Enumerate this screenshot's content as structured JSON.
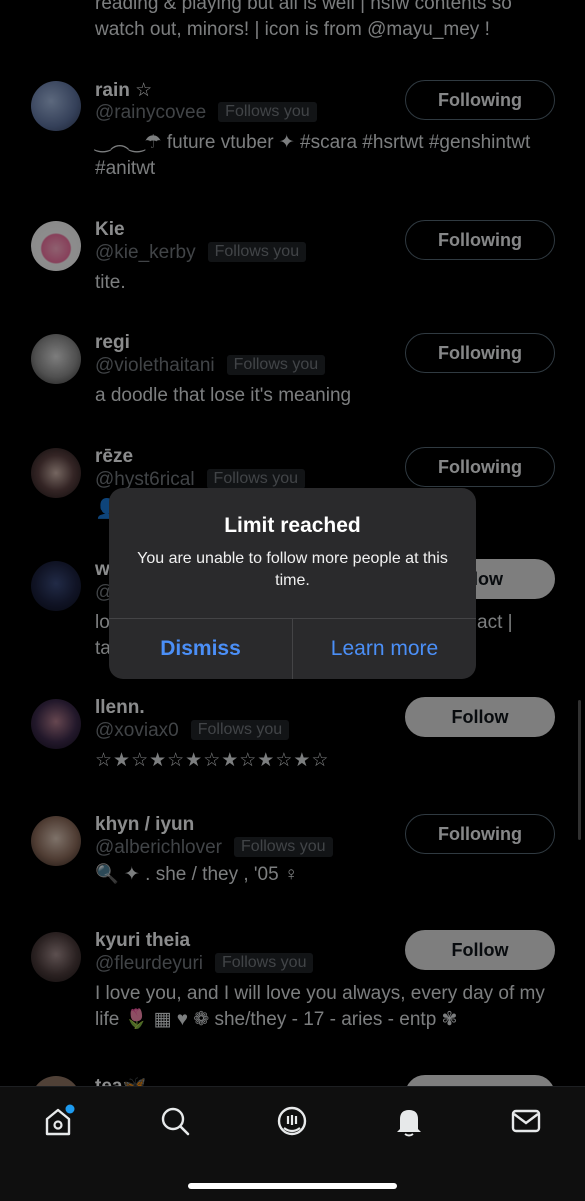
{
  "top_bio": {
    "line1": "reading & playing but all is well | nsfw contents so",
    "line2": "watch out, minors! | icon is from @mayu_mey !"
  },
  "users": [
    {
      "name": "rain ☆",
      "handle": "@rainycovee",
      "badge": "Follows you",
      "bio": "‿︵‿☂ future vtuber ✦ #scara #hsrtwt #genshintwt #anitwt",
      "button": "Following"
    },
    {
      "name": "Kie",
      "handle": "@kie_kerby",
      "badge": "Follows you",
      "bio": "tite.",
      "button": "Following"
    },
    {
      "name": "regi",
      "handle": "@violethaitani",
      "badge": "Follows you",
      "bio": "a doodle that lose it's meaning",
      "button": "Following"
    },
    {
      "name": "rēze",
      "handle": "@hyst6rical",
      "badge": "Follows you",
      "bio": "👤",
      "button": "Following"
    },
    {
      "name": "w",
      "handle": "@",
      "badge": "",
      "bio_line1": "lo",
      "bio_line1_end": "act |",
      "bio_line2": "ta",
      "button": "llow"
    },
    {
      "name": "llenn.",
      "handle": "@xoviax0",
      "badge": "Follows you",
      "bio": "☆★☆★☆★☆★☆★☆★☆",
      "button": "Follow"
    },
    {
      "name": "khyn / iyun",
      "handle": "@alberichlover",
      "badge": "Follows you",
      "bio": "🔍 ✦ .  she / they , '05 ♀",
      "button": "Following"
    },
    {
      "name": "kyuri theia",
      "handle": "@fleurdeyuri",
      "badge": "Follows you",
      "bio": "I love you, and I will love you always, every day of my life 🌷 ▦ ♥ ❁ she/they - 17 - aries - entp ✾",
      "button": "Follow"
    },
    {
      "name": "tea🦋",
      "handle": "",
      "badge": "",
      "bio": "",
      "button": ""
    }
  ],
  "dialog": {
    "title": "Limit reached",
    "message": "You are unable to follow more people at this time.",
    "dismiss": "Dismiss",
    "learn_more": "Learn more"
  },
  "tabbar": {
    "icons": [
      "home-icon",
      "search-icon",
      "grok-icon",
      "bell-icon",
      "mail-icon"
    ],
    "home_dot_color": "#1d9bf0"
  }
}
